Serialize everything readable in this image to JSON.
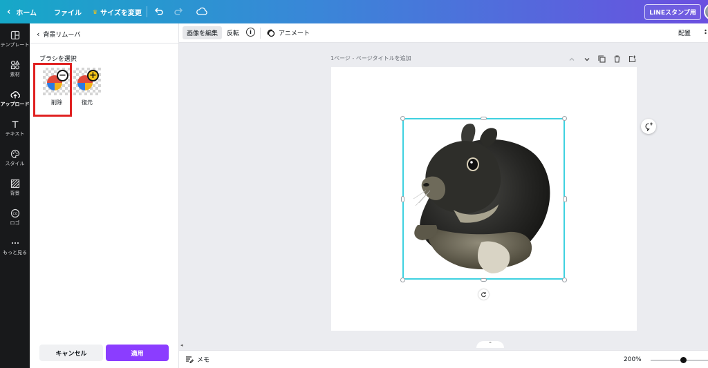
{
  "topbar": {
    "home": "ホーム",
    "file": "ファイル",
    "resize": "サイズを変更",
    "line_stamp": "LINEスタンプ用"
  },
  "leftnav": {
    "items": [
      {
        "label": "テンプレート",
        "icon": "template-icon"
      },
      {
        "label": "素材",
        "icon": "elements-icon"
      },
      {
        "label": "アップロード",
        "icon": "upload-cloud-icon",
        "active": true
      },
      {
        "label": "テキスト",
        "icon": "text-icon"
      },
      {
        "label": "スタイル",
        "icon": "palette-icon"
      },
      {
        "label": "背景",
        "icon": "background-icon"
      },
      {
        "label": "ロゴ",
        "icon": "logo-icon"
      },
      {
        "label": "もっと見る",
        "icon": "more-icon"
      }
    ]
  },
  "panel": {
    "title": "背景リムーバ",
    "brush_label": "ブラシを選択",
    "brushes": [
      {
        "label": "削除",
        "icon": "erase-brush-icon",
        "selected": true
      },
      {
        "label": "復元",
        "icon": "restore-brush-icon",
        "selected": false
      }
    ],
    "cancel": "キャンセル",
    "apply": "適用"
  },
  "toolbar": {
    "edit_image": "画像を編集",
    "flip": "反転",
    "animate": "アニメート",
    "arrange": "配置"
  },
  "canvas": {
    "page_title": "1ページ - ページタイトルを追加"
  },
  "footer": {
    "memo": "メモ",
    "zoom": "200%",
    "zoom_level_fraction": 0.55
  },
  "colors": {
    "accent": "#8b3dff",
    "selection": "#3ed1e0",
    "highlight": "#e02020"
  }
}
